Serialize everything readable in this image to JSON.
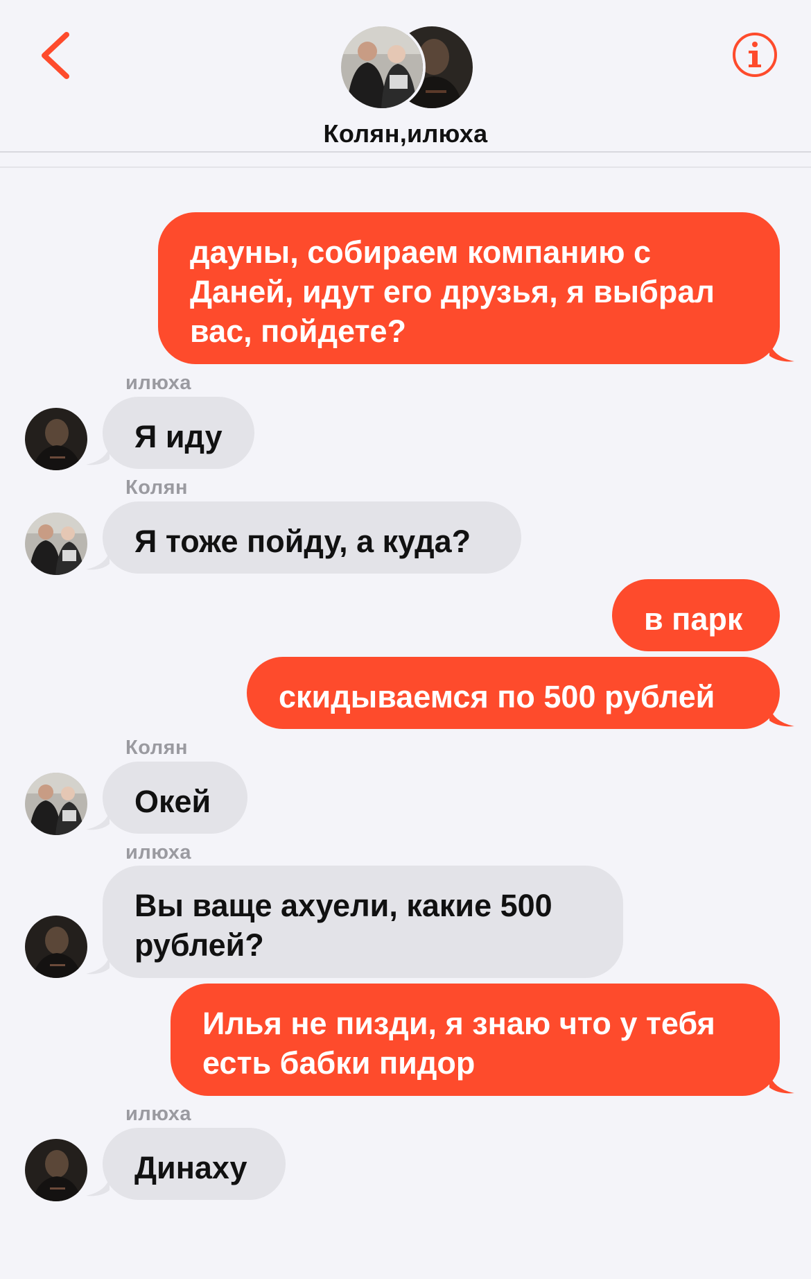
{
  "header": {
    "title": "Колян,илюха",
    "back_icon": "chevron-left-icon",
    "info_icon": "info-icon",
    "accent_color": "#fe4b2c"
  },
  "messages": [
    {
      "type": "outgoing",
      "lines": [
        "дауны, собираем компанию с",
        "Даней, идут его друзья, я выбрал",
        "вас, пойдете?"
      ]
    },
    {
      "type": "incoming",
      "sender": "илюха",
      "lines": [
        "Я иду"
      ]
    },
    {
      "type": "incoming",
      "sender": "Колян",
      "lines": [
        "Я тоже пойду, а куда?"
      ]
    },
    {
      "type": "outgoing",
      "lines": [
        "в парк"
      ]
    },
    {
      "type": "outgoing",
      "lines": [
        "скидываемся по 500 рублей"
      ]
    },
    {
      "type": "incoming",
      "sender": "Колян",
      "lines": [
        "Окей"
      ]
    },
    {
      "type": "incoming",
      "sender": "илюха",
      "lines": [
        "Вы ваще ахуели, какие 500",
        "рублей?"
      ]
    },
    {
      "type": "outgoing",
      "lines": [
        "Илья не пизди, я знаю что у тебя",
        "есть бабки пидор"
      ]
    },
    {
      "type": "incoming",
      "sender": "илюха",
      "lines": [
        "Динаху"
      ]
    }
  ],
  "colors": {
    "outgoing_bubble": "#fe4b2c",
    "incoming_bubble": "#e3e3e8",
    "background": "#f4f4f9",
    "sender_label": "#9a9aa0"
  }
}
